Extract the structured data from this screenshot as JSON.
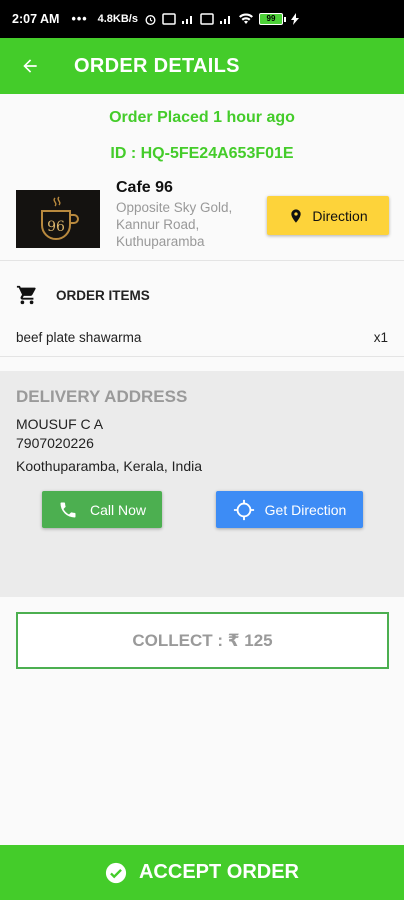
{
  "status_bar": {
    "time": "2:07 AM",
    "dots": "•••",
    "speed": "4.8KB/s",
    "battery": "99"
  },
  "header": {
    "title": "ORDER DETAILS"
  },
  "order": {
    "status": "Order Placed 1 hour ago",
    "id": "ID : HQ-5FE24A653F01E"
  },
  "restaurant": {
    "name": "Cafe 96",
    "address": "Opposite Sky Gold, Kannur Road, Kuthuparamba",
    "direction_label": "Direction",
    "logo_text": "96"
  },
  "order_items": {
    "title": "ORDER ITEMS",
    "items": [
      {
        "name": "beef plate shawarma",
        "qty": "x1"
      }
    ]
  },
  "delivery": {
    "label": "DELIVERY ADDRESS",
    "customer_name": "MOUSUF C A",
    "phone": "7907020226",
    "address": "Koothuparamba, Kerala, India",
    "call_label": "Call Now",
    "get_direction_label": "Get Direction"
  },
  "collect": {
    "text": "COLLECT : ₹ 125"
  },
  "footer": {
    "accept_label": "ACCEPT ORDER"
  },
  "colors": {
    "brand_green": "#44cc2a",
    "call_green": "#4caf50",
    "direction_yellow": "#fdd33a",
    "get_direction_blue": "#3d8cf5"
  }
}
